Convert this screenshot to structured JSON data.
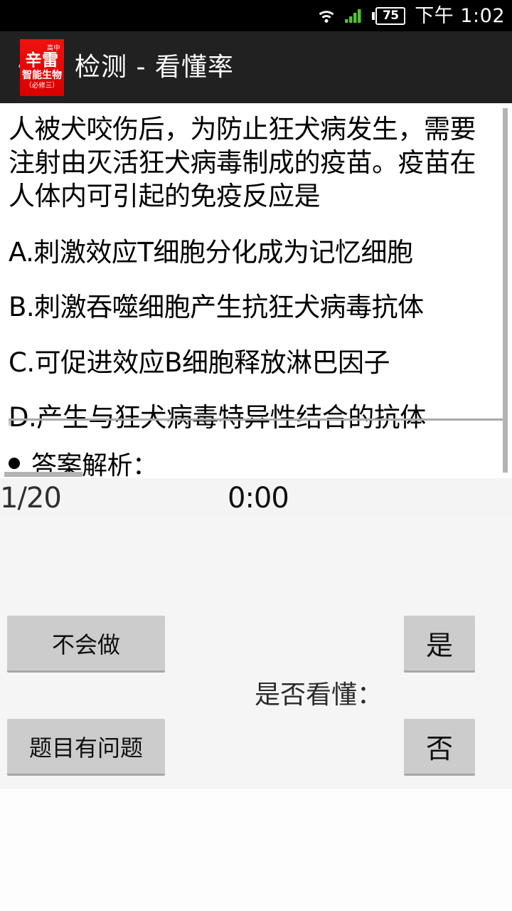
{
  "status_bar": {
    "wifi_icon": "wifi-icon",
    "signal_icon": "cellular-signal-icon",
    "battery_icon": "battery-icon",
    "battery_level": "75",
    "time": "下午 1:02",
    "signal_color": "#52c234",
    "background": "#000000"
  },
  "title_bar": {
    "back_icon": "back-chevron-icon",
    "back_glyph": "〈",
    "logo": {
      "top_text": "高中",
      "main_text": "辛雷",
      "sub_text": "智能生物",
      "note_text": "（必修三）",
      "background": "#e60000"
    },
    "title": "检测 - 看懂率",
    "background": "#212121"
  },
  "question": {
    "stem": "人被犬咬伤后，为防止狂犬病发生，需要注射由灭活狂犬病毒制成的疫苗。疫苗在人体内可引起的免疫反应是",
    "options": [
      "A.刺激效应T细胞分化成为记忆细胞",
      "B.刺激吞噬细胞产生抗狂犬病毒抗体",
      "C.可促进效应B细胞释放淋巴因子",
      "D.产生与狂犬病毒特异性结合的抗体"
    ],
    "analysis_label": "答案解析：",
    "analysis_bullet": "bullet-icon"
  },
  "counter_bar": {
    "index": "1/20",
    "timer": "0:00",
    "background": "#f4f4f4"
  },
  "bottom_panel": {
    "understand_label": "是否看懂：",
    "buttons": {
      "cant_do": "不会做",
      "bad_question": "题目有问题",
      "yes": "是",
      "no": "否"
    },
    "button_color": "#cccccc",
    "background": "#f5f5f5"
  }
}
